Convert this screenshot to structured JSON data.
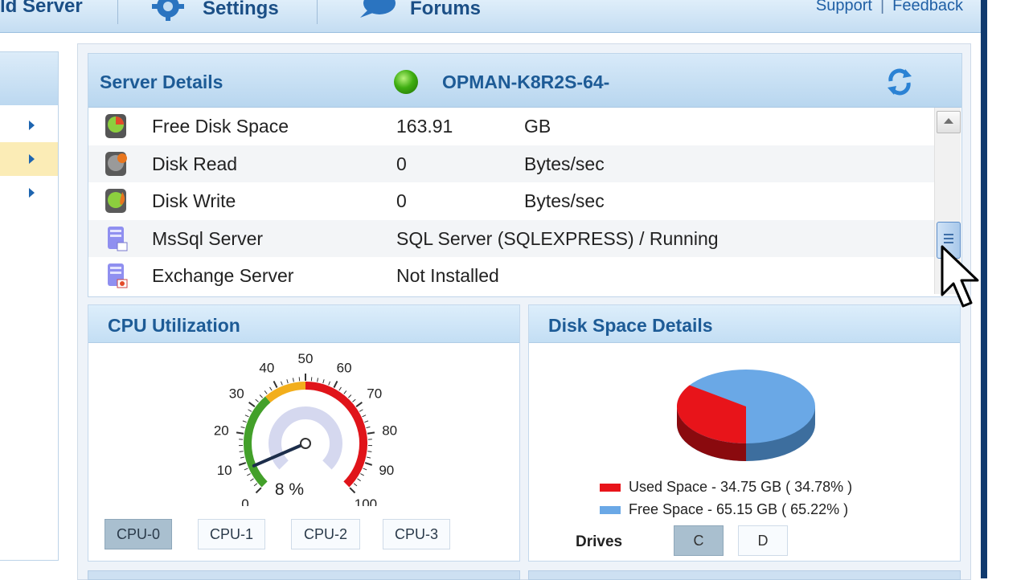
{
  "nav": {
    "add_server": "ld Server",
    "settings": "Settings",
    "forums": "Forums",
    "support": "Support",
    "feedback": "Feedback",
    "separator": "|"
  },
  "server_details": {
    "title": "Server Details",
    "status_color": "#3fae12",
    "server_name": "OPMAN-K8R2S-64-",
    "rows": [
      {
        "label": "Free Disk Space",
        "value": "163.91",
        "unit": "GB",
        "icon": "disk-space-icon"
      },
      {
        "label": "Disk Read",
        "value": "0",
        "unit": "Bytes/sec",
        "icon": "disk-read-icon"
      },
      {
        "label": "Disk Write",
        "value": "0",
        "unit": "Bytes/sec",
        "icon": "disk-write-icon"
      },
      {
        "label": "MsSql Server",
        "value": "SQL Server (SQLEXPRESS) / Running",
        "unit": "",
        "icon": "database-icon"
      },
      {
        "label": "Exchange Server",
        "value": "Not Installed",
        "unit": "",
        "icon": "exchange-server-icon"
      }
    ]
  },
  "cpu": {
    "title": "CPU Utilization",
    "value": 8,
    "readout": "8 %",
    "ticks": [
      "0",
      "10",
      "20",
      "30",
      "40",
      "50",
      "60",
      "70",
      "80",
      "90",
      "100"
    ],
    "buttons": [
      "CPU-0",
      "CPU-1",
      "CPU-2",
      "CPU-3"
    ],
    "active_button": "CPU-0"
  },
  "disk": {
    "title": "Disk Space Details",
    "used_label": "Used Space - 34.75 GB ( 34.78% )",
    "free_label": "Free Space - 65.15 GB ( 65.22% )",
    "used_color": "#e8141a",
    "free_color": "#6aa8e6",
    "used_percent": 34.78,
    "free_percent": 65.22,
    "drives_label": "Drives",
    "drives": [
      "C",
      "D"
    ],
    "active_drive": "C"
  }
}
